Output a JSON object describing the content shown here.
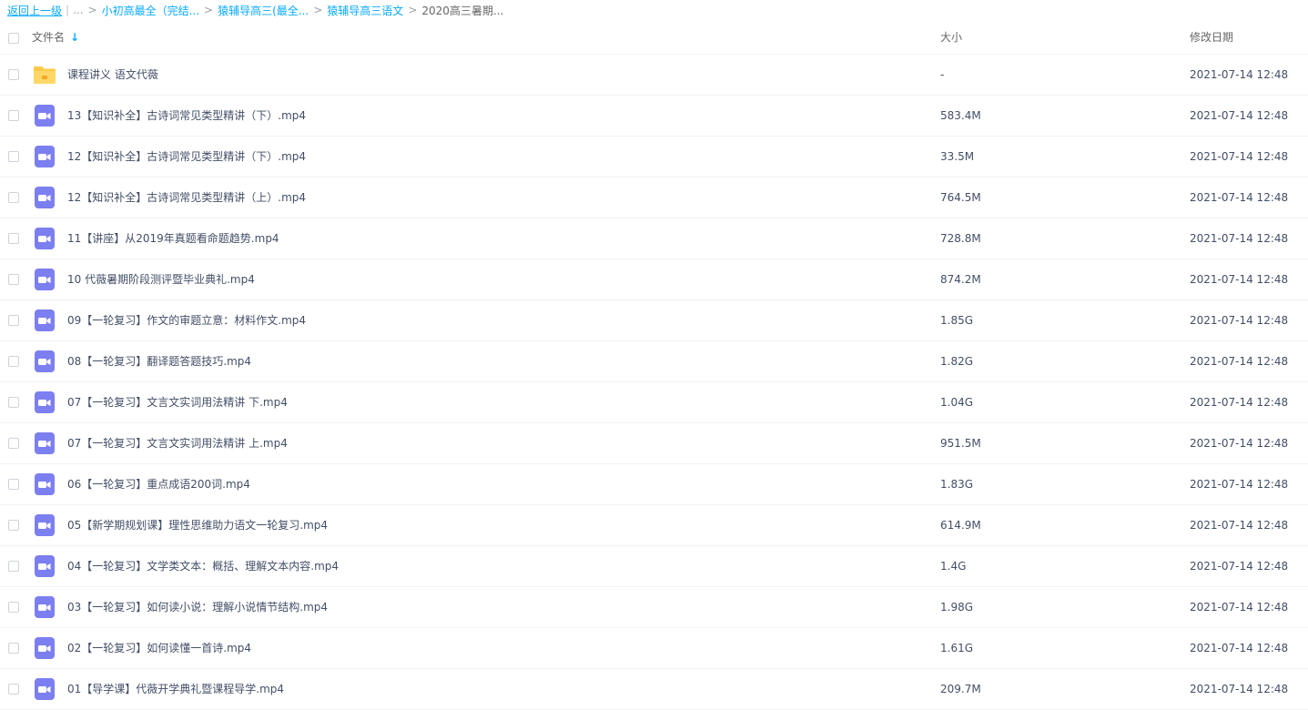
{
  "breadcrumb": {
    "back": "返回上一级",
    "bar": "|",
    "ellipsis": "...",
    "sep": ">",
    "links": [
      "小初高最全（完结...",
      "猿辅导高三(最全...",
      "猿辅导高三语文"
    ],
    "current": "2020高三暑期..."
  },
  "header": {
    "name": "文件名",
    "sort_arrow": "↓",
    "size": "大小",
    "date": "修改日期"
  },
  "colors": {
    "accent": "#09aaff",
    "folder": "#ffc94a",
    "video": "#7c7ff0"
  },
  "files": [
    {
      "type": "folder",
      "name": "课程讲义 语文代薇",
      "size": "-",
      "date": "2021-07-14 12:48"
    },
    {
      "type": "video",
      "name": "13【知识补全】古诗词常见类型精讲（下）.mp4",
      "size": "583.4M",
      "date": "2021-07-14 12:48"
    },
    {
      "type": "video",
      "name": "12【知识补全】古诗词常见类型精讲（下）.mp4",
      "size": "33.5M",
      "date": "2021-07-14 12:48"
    },
    {
      "type": "video",
      "name": "12【知识补全】古诗词常见类型精讲（上）.mp4",
      "size": "764.5M",
      "date": "2021-07-14 12:48"
    },
    {
      "type": "video",
      "name": "11【讲座】从2019年真题看命题趋势.mp4",
      "size": "728.8M",
      "date": "2021-07-14 12:48"
    },
    {
      "type": "video",
      "name": "10 代薇暑期阶段测评暨毕业典礼.mp4",
      "size": "874.2M",
      "date": "2021-07-14 12:48"
    },
    {
      "type": "video",
      "name": "09【一轮复习】作文的审题立意：材料作文.mp4",
      "size": "1.85G",
      "date": "2021-07-14 12:48"
    },
    {
      "type": "video",
      "name": "08【一轮复习】翻译题答题技巧.mp4",
      "size": "1.82G",
      "date": "2021-07-14 12:48"
    },
    {
      "type": "video",
      "name": "07【一轮复习】文言文实词用法精讲 下.mp4",
      "size": "1.04G",
      "date": "2021-07-14 12:48"
    },
    {
      "type": "video",
      "name": "07【一轮复习】文言文实词用法精讲 上.mp4",
      "size": "951.5M",
      "date": "2021-07-14 12:48"
    },
    {
      "type": "video",
      "name": "06【一轮复习】重点成语200词.mp4",
      "size": "1.83G",
      "date": "2021-07-14 12:48"
    },
    {
      "type": "video",
      "name": "05【新学期规划课】理性思维助力语文一轮复习.mp4",
      "size": "614.9M",
      "date": "2021-07-14 12:48"
    },
    {
      "type": "video",
      "name": "04【一轮复习】文学类文本：概括、理解文本内容.mp4",
      "size": "1.4G",
      "date": "2021-07-14 12:48"
    },
    {
      "type": "video",
      "name": "03【一轮复习】如何读小说：理解小说情节结构.mp4",
      "size": "1.98G",
      "date": "2021-07-14 12:48"
    },
    {
      "type": "video",
      "name": "02【一轮复习】如何读懂一首诗.mp4",
      "size": "1.61G",
      "date": "2021-07-14 12:48"
    },
    {
      "type": "video",
      "name": "01【导学课】代薇开学典礼暨课程导学.mp4",
      "size": "209.7M",
      "date": "2021-07-14 12:48"
    }
  ]
}
